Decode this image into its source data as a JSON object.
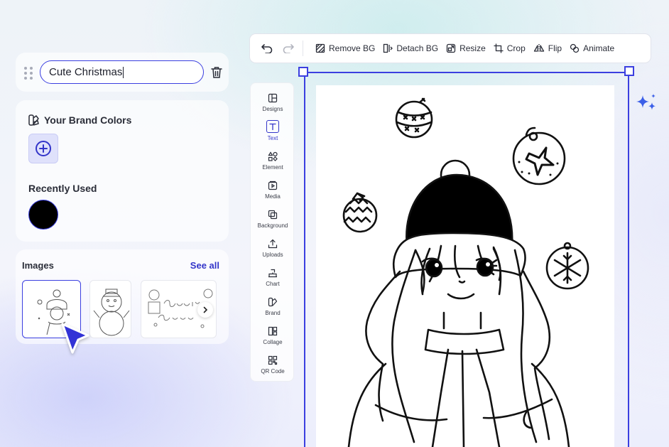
{
  "design_name": {
    "value": "Cute Christmas"
  },
  "colors": {
    "brand_title": "Your Brand Colors",
    "recent_title": "Recently Used",
    "recent_swatches": [
      "#000000"
    ],
    "accent": "#3b3fe0"
  },
  "images": {
    "title": "Images",
    "see_all": "See all",
    "thumbnails": [
      "girl-coloring-page",
      "snowman-coloring-page",
      "merry-christmas-coloring-page"
    ]
  },
  "toolbar": {
    "remove_bg": "Remove BG",
    "detach_bg": "Detach BG",
    "resize": "Resize",
    "crop": "Crop",
    "flip": "Flip",
    "animate": "Animate"
  },
  "sidebar": {
    "items": [
      {
        "label": "Designs",
        "icon": "designs-icon"
      },
      {
        "label": "Text",
        "icon": "text-icon",
        "active": true
      },
      {
        "label": "Element",
        "icon": "element-icon"
      },
      {
        "label": "Media",
        "icon": "media-icon"
      },
      {
        "label": "Background",
        "icon": "background-icon"
      },
      {
        "label": "Uploads",
        "icon": "upload-icon"
      },
      {
        "label": "Chart",
        "icon": "chart-icon"
      },
      {
        "label": "Brand",
        "icon": "brand-icon"
      },
      {
        "label": "Collage",
        "icon": "collage-icon"
      },
      {
        "label": "QR Code",
        "icon": "qr-code-icon"
      }
    ]
  }
}
